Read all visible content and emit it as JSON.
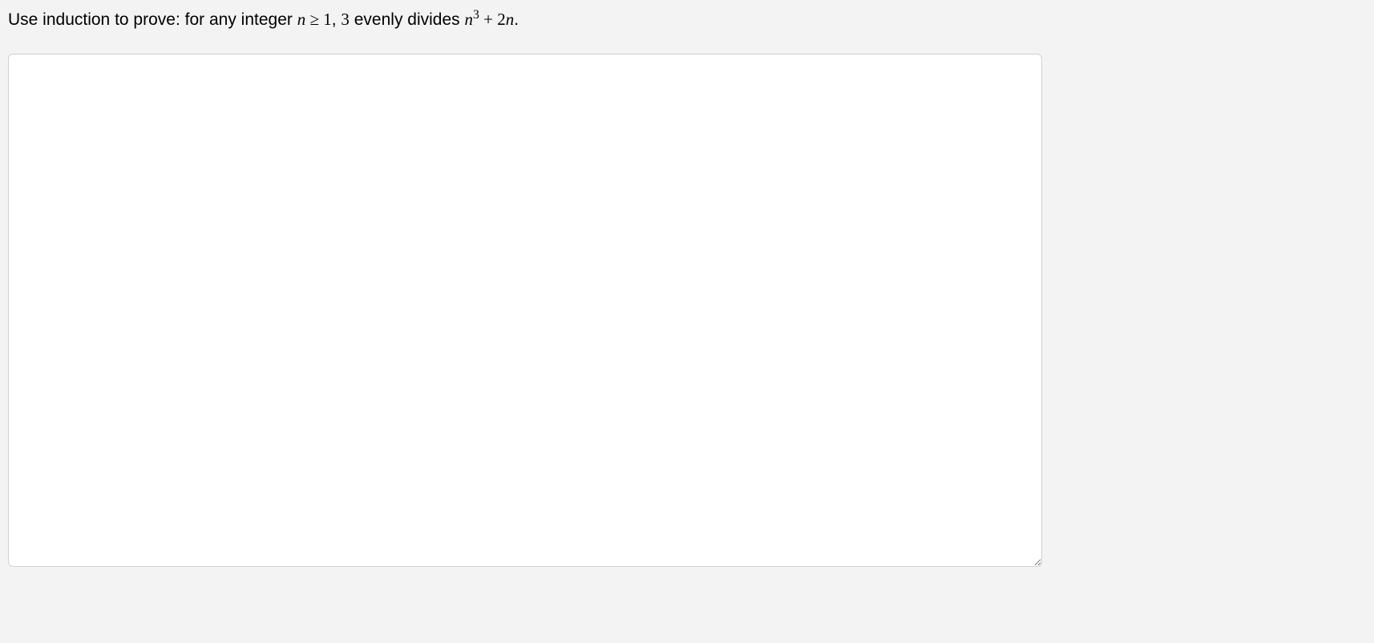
{
  "prompt": {
    "text_before": "Use induction to prove: for any integer ",
    "math_part_1_var": "n",
    "math_part_1_op": " ≥ ",
    "math_part_1_num": "1",
    "text_mid": ", ",
    "math_part_2_num": "3",
    "text_mid2": " evenly divides ",
    "math_part_3_var": "n",
    "math_part_3_sup": "3",
    "math_part_3_op": " + ",
    "math_part_3_num": "2",
    "math_part_3_var2": "n",
    "text_end": "."
  },
  "answer_value": ""
}
